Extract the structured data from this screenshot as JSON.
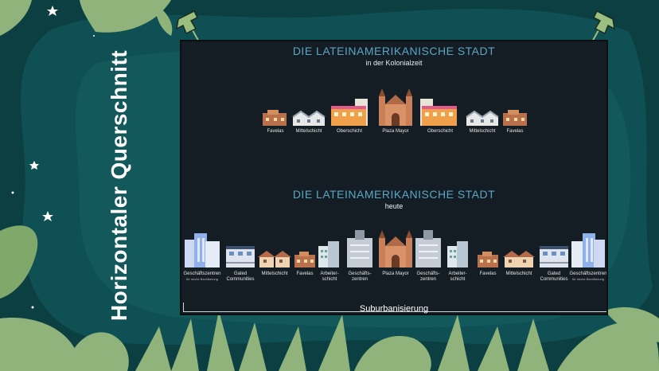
{
  "slide": {
    "vertical_title": "Horizontaler Querschnitt"
  },
  "colonial": {
    "title": "DIE LATEINAMERIKANISCHE STADT",
    "subtitle": "in der Kolonialzeit",
    "labels": [
      "Favelas",
      "Mittelschicht",
      "Oberschicht",
      "Plaza Mayor",
      "Oberschicht",
      "Mittelschicht",
      "Favelas"
    ]
  },
  "modern": {
    "title": "DIE LATEINAMERIKANISCHE STADT",
    "subtitle": "heute",
    "labels": [
      {
        "l1": "Geschäftszentren",
        "sub": "für reiche Bevölkerung"
      },
      {
        "l1": "Gated",
        "l2": "Communities"
      },
      {
        "l1": "Mittelschicht"
      },
      {
        "l1": "Favelas"
      },
      {
        "l1": "Arbeiter-",
        "l2": "schicht"
      },
      {
        "l1": "Geschäfts-",
        "l2": "zentren"
      },
      {
        "l1": "Plaza Mayor"
      },
      {
        "l1": "Geschäfts-",
        "l2": "zentren"
      },
      {
        "l1": "Arbeiter-",
        "l2": "schicht"
      },
      {
        "l1": "Favelas"
      },
      {
        "l1": "Mittelschicht"
      },
      {
        "l1": "Gated",
        "l2": "Communities"
      },
      {
        "l1": "Geschäftszentren",
        "sub": "für reiche Bevölkerung"
      }
    ],
    "bottom_label": "Suburbanisierung"
  },
  "colors": {
    "background": "#0b3f42",
    "panel": "#141d24",
    "title_accent": "#5aa6c4",
    "leaf": "#8fb37a"
  }
}
